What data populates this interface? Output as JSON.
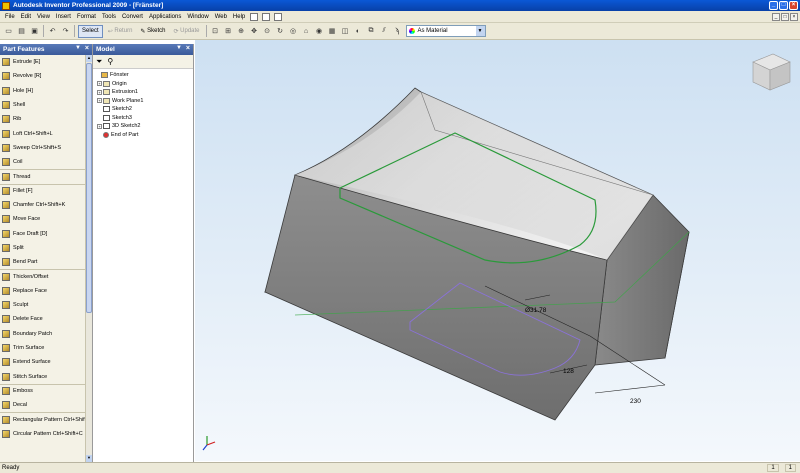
{
  "window": {
    "title": "Autodesk Inventor Professional 2009 - [Fränster]",
    "minimize": "_",
    "maximize": "□",
    "close": "×"
  },
  "menu": [
    "File",
    "Edit",
    "View",
    "Insert",
    "Format",
    "Tools",
    "Convert",
    "Applications",
    "Window",
    "Web",
    "Help"
  ],
  "toolbar": {
    "select": "Select",
    "return": "Return",
    "sketch": "Sketch",
    "update": "Update",
    "material": "As Material"
  },
  "features_panel": {
    "title": "Part Features",
    "items": [
      {
        "label": "Extrude   [E]",
        "sep": false
      },
      {
        "label": "Revolve   [R]",
        "sep": false
      },
      {
        "label": "Hole   [H]",
        "sep": false
      },
      {
        "label": "Shell",
        "sep": false
      },
      {
        "label": "Rib",
        "sep": false
      },
      {
        "label": "Loft   Ctrl+Shift+L",
        "sep": false
      },
      {
        "label": "Sweep   Ctrl+Shift+S",
        "sep": false
      },
      {
        "label": "Coil",
        "sep": false
      },
      {
        "label": "Thread",
        "sep": true
      },
      {
        "label": "Fillet   [F]",
        "sep": true
      },
      {
        "label": "Chamfer   Ctrl+Shift+K",
        "sep": false
      },
      {
        "label": "Move Face",
        "sep": false
      },
      {
        "label": "Face Draft   [D]",
        "sep": false
      },
      {
        "label": "Split",
        "sep": false
      },
      {
        "label": "Bend Part",
        "sep": false
      },
      {
        "label": "Thicken/Offset",
        "sep": true
      },
      {
        "label": "Replace Face",
        "sep": false
      },
      {
        "label": "Sculpt",
        "sep": false
      },
      {
        "label": "Delete Face",
        "sep": false
      },
      {
        "label": "Boundary Patch",
        "sep": false
      },
      {
        "label": "Trim Surface",
        "sep": false
      },
      {
        "label": "Extend Surface",
        "sep": false
      },
      {
        "label": "Stitch Surface",
        "sep": false
      },
      {
        "label": "Emboss",
        "sep": true
      },
      {
        "label": "Decal",
        "sep": false
      },
      {
        "label": "Rectangular Pattern   Ctrl+Shift+N",
        "sep": true
      },
      {
        "label": "Circular Pattern   Ctrl+Shift+C",
        "sep": false
      }
    ]
  },
  "model_panel": {
    "title": "Model",
    "tree": [
      {
        "label": "Fönster",
        "indent": 0,
        "expander": "",
        "kind": "root"
      },
      {
        "label": "Origin",
        "indent": 1,
        "expander": "+",
        "kind": "folder"
      },
      {
        "label": "Extrusion1",
        "indent": 1,
        "expander": "+",
        "kind": "feature"
      },
      {
        "label": "Work Plane1",
        "indent": 1,
        "expander": "+",
        "kind": "feature"
      },
      {
        "label": "Sketch2",
        "indent": 1,
        "expander": "",
        "kind": "sketch"
      },
      {
        "label": "Sketch3",
        "indent": 1,
        "expander": "",
        "kind": "sketch"
      },
      {
        "label": "3D Sketch2",
        "indent": 1,
        "expander": "+",
        "kind": "sketch"
      },
      {
        "label": "End of Part",
        "indent": 1,
        "expander": "",
        "kind": "end"
      }
    ]
  },
  "viewport": {
    "dimensions": [
      "Ø31.78",
      "128",
      "230"
    ]
  },
  "status": {
    "text": "Ready",
    "count1": "1",
    "count2": "1"
  }
}
